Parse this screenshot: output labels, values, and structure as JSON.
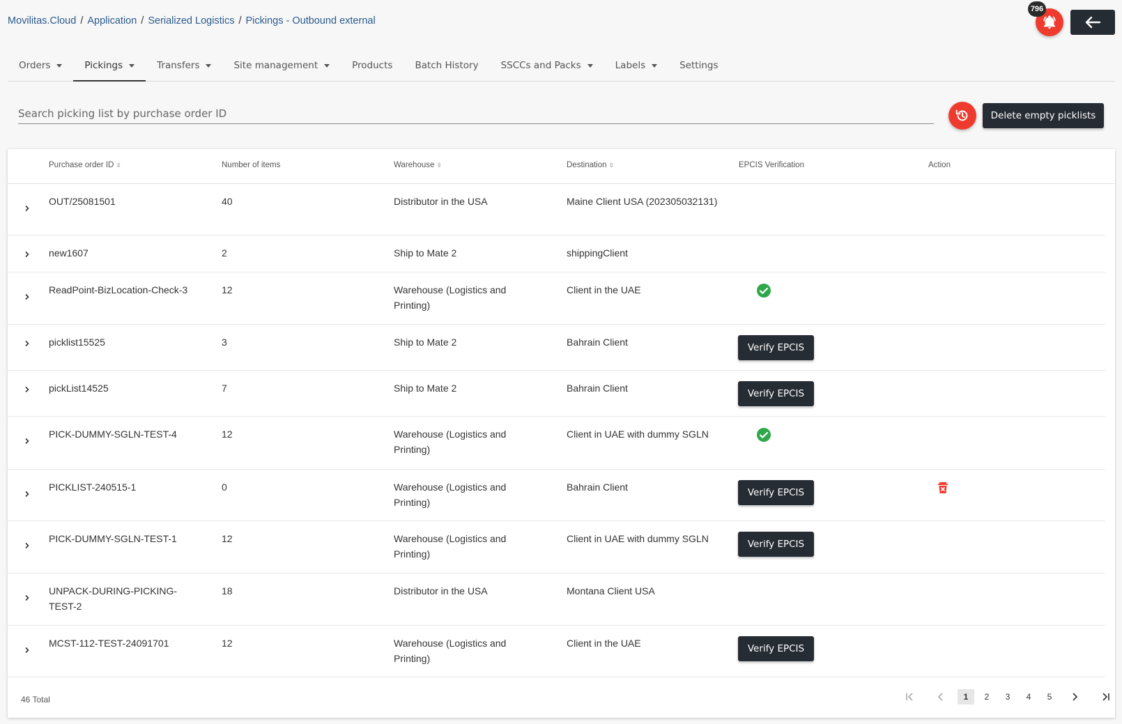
{
  "breadcrumb": {
    "items": [
      "Movilitas.Cloud",
      "Application",
      "Serialized Logistics",
      "Pickings - Outbound external"
    ],
    "separator": "/"
  },
  "header": {
    "notification_count": "796",
    "bell_icon": "bell-icon",
    "back_icon": "arrow-left-icon"
  },
  "tabs": [
    {
      "label": "Orders",
      "dropdown": true
    },
    {
      "label": "Pickings",
      "dropdown": true,
      "active": true
    },
    {
      "label": "Transfers",
      "dropdown": true
    },
    {
      "label": "Site management",
      "dropdown": true
    },
    {
      "label": "Products",
      "dropdown": false
    },
    {
      "label": "Batch History",
      "dropdown": false
    },
    {
      "label": "SSCCs and Packs",
      "dropdown": true
    },
    {
      "label": "Labels",
      "dropdown": true
    },
    {
      "label": "Settings",
      "dropdown": false
    }
  ],
  "search": {
    "placeholder": "Search picking list by purchase order ID",
    "value": ""
  },
  "toolbar": {
    "reset_icon": "history-icon",
    "delete_empty_label": "Delete empty picklists"
  },
  "table": {
    "columns": [
      {
        "label": "Purchase order ID",
        "sortable": true
      },
      {
        "label": "Number of items",
        "sortable": false
      },
      {
        "label": "Warehouse",
        "sortable": true
      },
      {
        "label": "Destination",
        "sortable": true
      },
      {
        "label": "EPCIS Verification",
        "sortable": false
      },
      {
        "label": "Action",
        "sortable": false
      }
    ],
    "verify_label": "Verify EPCIS",
    "rows": [
      {
        "po": "OUT/25081501",
        "items": "40",
        "warehouse": "Distributor in the USA",
        "destination": "Maine Client USA (202305032131)",
        "epcis": "none",
        "action": ""
      },
      {
        "po": "new1607",
        "items": "2",
        "warehouse": "Ship to Mate 2",
        "destination": "shippingClient",
        "epcis": "none",
        "action": ""
      },
      {
        "po": "ReadPoint-BizLocation-Check-3",
        "items": "12",
        "warehouse": "Warehouse (Logistics and Printing)",
        "destination": "Client in the UAE",
        "epcis": "verified",
        "action": ""
      },
      {
        "po": "picklist15525",
        "items": "3",
        "warehouse": "Ship to Mate 2",
        "destination": "Bahrain Client",
        "epcis": "button",
        "action": ""
      },
      {
        "po": "pickList14525",
        "items": "7",
        "warehouse": "Ship to Mate 2",
        "destination": "Bahrain Client",
        "epcis": "button",
        "action": ""
      },
      {
        "po": "PICK-DUMMY-SGLN-TEST-4",
        "items": "12",
        "warehouse": "Warehouse (Logistics and Printing)",
        "destination": "Client in UAE with dummy SGLN",
        "epcis": "verified",
        "action": ""
      },
      {
        "po": "PICKLIST-240515-1",
        "items": "0",
        "warehouse": "Warehouse (Logistics and Printing)",
        "destination": "Bahrain Client",
        "epcis": "button",
        "action": "delete"
      },
      {
        "po": "PICK-DUMMY-SGLN-TEST-1",
        "items": "12",
        "warehouse": "Warehouse (Logistics and Printing)",
        "destination": "Client in UAE with dummy SGLN",
        "epcis": "button",
        "action": ""
      },
      {
        "po": "UNPACK-DURING-PICKING-TEST-2",
        "items": "18",
        "warehouse": "Distributor in the USA",
        "destination": "Montana Client USA",
        "epcis": "none",
        "action": ""
      },
      {
        "po": "MCST-112-TEST-24091701",
        "items": "12",
        "warehouse": "Warehouse (Logistics and Printing)",
        "destination": "Client in the UAE",
        "epcis": "button",
        "action": ""
      }
    ]
  },
  "pagination": {
    "total_label": "46 Total",
    "pages": [
      "1",
      "2",
      "3",
      "4",
      "5"
    ],
    "current": "1"
  },
  "colors": {
    "accent_red": "#ef3b2e",
    "dark_button": "#262c33",
    "success_green": "#2ea84a"
  }
}
